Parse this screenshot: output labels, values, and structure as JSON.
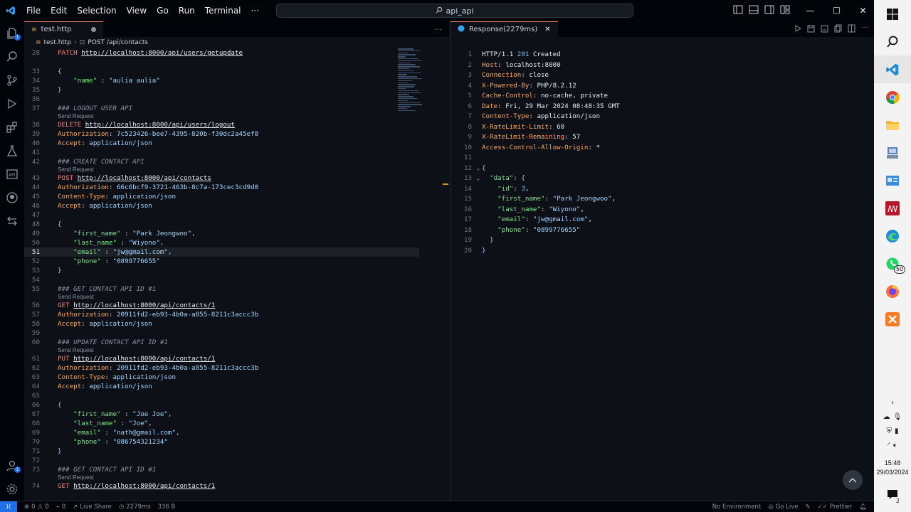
{
  "titlebar": {
    "menus": [
      "File",
      "Edit",
      "Selection",
      "View",
      "Go",
      "Run",
      "Terminal",
      "···"
    ],
    "search_text": "api_api"
  },
  "editor": {
    "tab_label": "test.http",
    "breadcrumb_file": "test.http",
    "breadcrumb_request": "POST /api/contacts",
    "codelens": "Send Request",
    "lines": [
      {
        "n": "28",
        "t": "req",
        "method": "PATCH",
        "url": "http://localhost:8000/api/users/getupdate"
      },
      {
        "n": "",
        "t": "blank"
      },
      {
        "n": "33",
        "t": "brace",
        "text": "{"
      },
      {
        "n": "34",
        "t": "kv",
        "key": "\"name\"",
        "sep": " : ",
        "val": "\"aulia aulia\"",
        "end": ""
      },
      {
        "n": "35",
        "t": "brace",
        "text": "}"
      },
      {
        "n": "36",
        "t": "blank"
      },
      {
        "n": "37",
        "t": "comment",
        "text": "### LOGOUT USER API"
      },
      {
        "n": "",
        "t": "lens"
      },
      {
        "n": "38",
        "t": "req",
        "method": "DELETE",
        "url": "http://localhost:8000/api/users/logout"
      },
      {
        "n": "39",
        "t": "header",
        "key": "Authorization",
        "val": "7c523426-bee7-4395-820b-f30dc2a45ef8"
      },
      {
        "n": "40",
        "t": "header",
        "key": "Accept",
        "val": "application/json"
      },
      {
        "n": "41",
        "t": "blank"
      },
      {
        "n": "42",
        "t": "comment",
        "text": "### CREATE CONTACT API"
      },
      {
        "n": "",
        "t": "lens"
      },
      {
        "n": "43",
        "t": "req",
        "method": "POST",
        "url": "http://localhost:8000/api/contacts"
      },
      {
        "n": "44",
        "t": "header",
        "key": "Authorization",
        "val": "66c6bcf9-3721-463b-8c7a-173cec3cd9d0"
      },
      {
        "n": "45",
        "t": "header",
        "key": "Content-Type",
        "val": "application/json"
      },
      {
        "n": "46",
        "t": "header",
        "key": "Accept",
        "val": "application/json"
      },
      {
        "n": "47",
        "t": "blank"
      },
      {
        "n": "48",
        "t": "brace",
        "text": "{"
      },
      {
        "n": "49",
        "t": "kv",
        "key": "\"first_name\"",
        "sep": " : ",
        "val": "\"Park Jeongwoo\"",
        "end": ","
      },
      {
        "n": "50",
        "t": "kv",
        "key": "\"last_name\"",
        "sep": " : ",
        "val": "\"Wiyono\"",
        "end": ","
      },
      {
        "n": "51",
        "t": "kv",
        "key": "\"email\"",
        "sep": " : ",
        "val": "\"jw@gmail.com\"",
        "end": ",",
        "current": true
      },
      {
        "n": "52",
        "t": "kv",
        "key": "\"phone\"",
        "sep": " : ",
        "val": "\"0899776655\"",
        "end": ""
      },
      {
        "n": "53",
        "t": "brace",
        "text": "}"
      },
      {
        "n": "54",
        "t": "blank"
      },
      {
        "n": "55",
        "t": "comment",
        "text": "### GET CONTACT API ID #1"
      },
      {
        "n": "",
        "t": "lens"
      },
      {
        "n": "56",
        "t": "req",
        "method": "GET",
        "url": "http://localhost:8000/api/contacts/1"
      },
      {
        "n": "57",
        "t": "header",
        "key": "Authorization",
        "val": "20911fd2-eb93-4b0a-a855-8211c3accc3b"
      },
      {
        "n": "58",
        "t": "header",
        "key": "Accept",
        "val": "application/json"
      },
      {
        "n": "59",
        "t": "blank"
      },
      {
        "n": "60",
        "t": "comment",
        "text": "### UPDATE CONTACT API ID #1"
      },
      {
        "n": "",
        "t": "lens"
      },
      {
        "n": "61",
        "t": "req",
        "method": "PUT",
        "url": "http://localhost:8000/api/contacts/1"
      },
      {
        "n": "62",
        "t": "header",
        "key": "Authorization",
        "val": "20911fd2-eb93-4b0a-a855-8211c3accc3b"
      },
      {
        "n": "63",
        "t": "header",
        "key": "Content-Type",
        "val": "application/json"
      },
      {
        "n": "64",
        "t": "header",
        "key": "Accept",
        "val": "application/json"
      },
      {
        "n": "65",
        "t": "blank"
      },
      {
        "n": "66",
        "t": "brace",
        "text": "{"
      },
      {
        "n": "67",
        "t": "kv",
        "key": "\"first_name\"",
        "sep": " : ",
        "val": "\"Joe Joe\"",
        "end": ","
      },
      {
        "n": "68",
        "t": "kv",
        "key": "\"last_name\"",
        "sep": " : ",
        "val": "\"Joe\"",
        "end": ","
      },
      {
        "n": "69",
        "t": "kv",
        "key": "\"email\"",
        "sep": " : ",
        "val": "\"nath@gmail.com\"",
        "end": ","
      },
      {
        "n": "70",
        "t": "kv",
        "key": "\"phone\"",
        "sep": " : ",
        "val": "\"086754321234\"",
        "end": ""
      },
      {
        "n": "71",
        "t": "brace",
        "text": "}"
      },
      {
        "n": "72",
        "t": "blank"
      },
      {
        "n": "73",
        "t": "comment",
        "text": "### GET CONTACT API ID #1"
      },
      {
        "n": "",
        "t": "lens"
      },
      {
        "n": "74",
        "t": "req",
        "method": "GET",
        "url": "http://localhost:8000/api/contacts/1"
      }
    ]
  },
  "response": {
    "tab_label": "Response(2279ms)",
    "lines": [
      {
        "n": "1",
        "t": "status",
        "text": "HTTP/1.1 ",
        "code": "201",
        "rest": " Created"
      },
      {
        "n": "2",
        "t": "header",
        "key": "Host",
        "val": "localhost:8000"
      },
      {
        "n": "3",
        "t": "header",
        "key": "Connection",
        "val": "close"
      },
      {
        "n": "4",
        "t": "header",
        "key": "X-Powered-By",
        "val": "PHP/8.2.12"
      },
      {
        "n": "5",
        "t": "header",
        "key": "Cache-Control",
        "val": "no-cache, private"
      },
      {
        "n": "6",
        "t": "header",
        "key": "Date",
        "val": "Fri, 29 Mar 2024 08:48:35 GMT"
      },
      {
        "n": "7",
        "t": "header",
        "key": "Content-Type",
        "val": "application/json"
      },
      {
        "n": "8",
        "t": "header",
        "key": "X-RateLimit-Limit",
        "val": "60"
      },
      {
        "n": "9",
        "t": "header",
        "key": "X-RateLimit-Remaining",
        "val": "57"
      },
      {
        "n": "10",
        "t": "header",
        "key": "Access-Control-Allow-Origin",
        "val": "*"
      },
      {
        "n": "11",
        "t": "blank"
      },
      {
        "n": "12",
        "t": "brace",
        "text": "{",
        "indent": 0,
        "fold": true
      },
      {
        "n": "13",
        "t": "obj",
        "key": "\"data\"",
        "indent": 1,
        "fold": true
      },
      {
        "n": "14",
        "t": "kv",
        "key": "\"id\"",
        "val": "3",
        "num": true,
        "end": ",",
        "indent": 2
      },
      {
        "n": "15",
        "t": "kv",
        "key": "\"first_name\"",
        "val": "\"Park Jeongwoo\"",
        "end": ",",
        "indent": 2
      },
      {
        "n": "16",
        "t": "kv",
        "key": "\"last_name\"",
        "val": "\"Wiyono\"",
        "end": ",",
        "indent": 2
      },
      {
        "n": "17",
        "t": "kv",
        "key": "\"email\"",
        "val": "\"jw@gmail.com\"",
        "end": ",",
        "indent": 2
      },
      {
        "n": "18",
        "t": "kv",
        "key": "\"phone\"",
        "val": "\"0899776655\"",
        "end": "",
        "indent": 2
      },
      {
        "n": "19",
        "t": "brace",
        "text": "}",
        "indent": 1
      },
      {
        "n": "20",
        "t": "brace",
        "text": "}",
        "indent": 0
      }
    ]
  },
  "statusbar": {
    "problems_errors": "0",
    "problems_warnings": "0",
    "ports": "0",
    "live_share": "Live Share",
    "timing": "2279ms",
    "size": "336 B",
    "environment": "No Environment",
    "go_live": "Go Live",
    "prettier": "Prettier"
  },
  "taskbar": {
    "whatsapp_badge": "50",
    "time": "15:48",
    "date": "29/03/2024",
    "notification_count": "2"
  },
  "activity": {
    "accounts_badge": "1"
  },
  "colors": {
    "editor_bg": "#0d1117",
    "accent_blue": "#1f6feb",
    "method_red": "#ff7b72",
    "header_orange": "#ffa657",
    "json_key_green": "#7ee787"
  }
}
